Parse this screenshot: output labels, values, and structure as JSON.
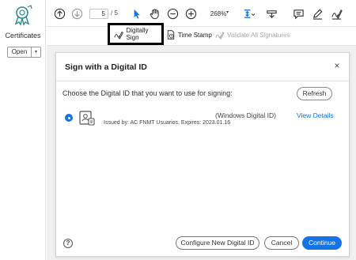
{
  "left_panel": {
    "title": "Certificates",
    "open_label": "Open",
    "open_arrow": "▾"
  },
  "toolbar": {
    "page_current": "5",
    "page_total": "/ 5",
    "zoom": "268%",
    "zoom_arrow": "▾",
    "icons": [
      "up-arrow-icon",
      "down-arrow-icon",
      "cursor-icon",
      "hand-icon",
      "zoom-out-icon",
      "zoom-in-icon",
      "page-layout-icon",
      "stamp-icon",
      "comment-icon",
      "pen-icon",
      "sign-icon"
    ]
  },
  "sig_toolbar": {
    "digitally_sign": "Digitally Sign",
    "time_stamp": "Time Stamp",
    "validate_all": "Validate All Signatures"
  },
  "dialog": {
    "title": "Sign with a Digital ID",
    "close": "×",
    "prompt": "Choose the Digital ID that you want to use for signing:",
    "refresh": "Refresh",
    "id_entry": {
      "type": "(Windows Digital ID)",
      "issued": "Issued by: AC FNMT Usuarios, Expires: 2023.01.16",
      "view_details": "View Details",
      "selected": true
    },
    "help": "?",
    "configure": "Configure New Digital ID",
    "cancel": "Cancel",
    "continue": "Continue"
  },
  "colors": {
    "accent": "#1473e6",
    "logo": "#2d8a8a",
    "backdrop": "#f0f0f0"
  }
}
